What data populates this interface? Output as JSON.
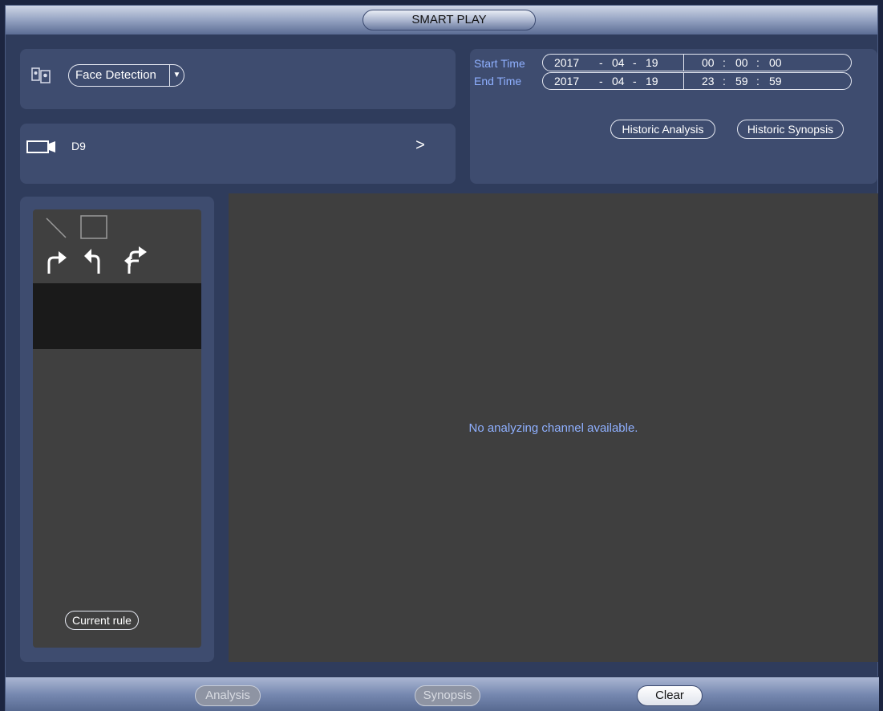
{
  "window": {
    "title": "SMART PLAY"
  },
  "mode": {
    "selected": "Face Detection"
  },
  "channel": {
    "label": "D9"
  },
  "time": {
    "start_label": "Start Time",
    "end_label": "End Time",
    "start": {
      "year": "2017",
      "month": "04",
      "day": "19",
      "hour": "00",
      "minute": "00",
      "second": "00"
    },
    "end": {
      "year": "2017",
      "month": "04",
      "day": "19",
      "hour": "23",
      "minute": "59",
      "second": "59"
    },
    "date_sep": "-",
    "time_sep": ":"
  },
  "actions": {
    "historic_analysis": "Historic Analysis",
    "historic_synopsis": "Historic Synopsis"
  },
  "rules": {
    "current_rule": "Current rule"
  },
  "video": {
    "message": "No analyzing channel available."
  },
  "footer": {
    "analysis": {
      "label": "Analysis",
      "enabled": false
    },
    "synopsis": {
      "label": "Synopsis",
      "enabled": false
    },
    "clear": {
      "label": "Clear",
      "enabled": true
    }
  },
  "icons": [
    "face-detection-mode-icon",
    "camera-icon",
    "chevron-right-icon",
    "line-tool-icon",
    "rectangle-tool-icon",
    "redo-icon",
    "undo-icon",
    "undo-redo-icon"
  ],
  "colors": {
    "accent_text": "#8fb0ff",
    "panel": "#3e4c6f",
    "background": "#2f3c5c"
  }
}
